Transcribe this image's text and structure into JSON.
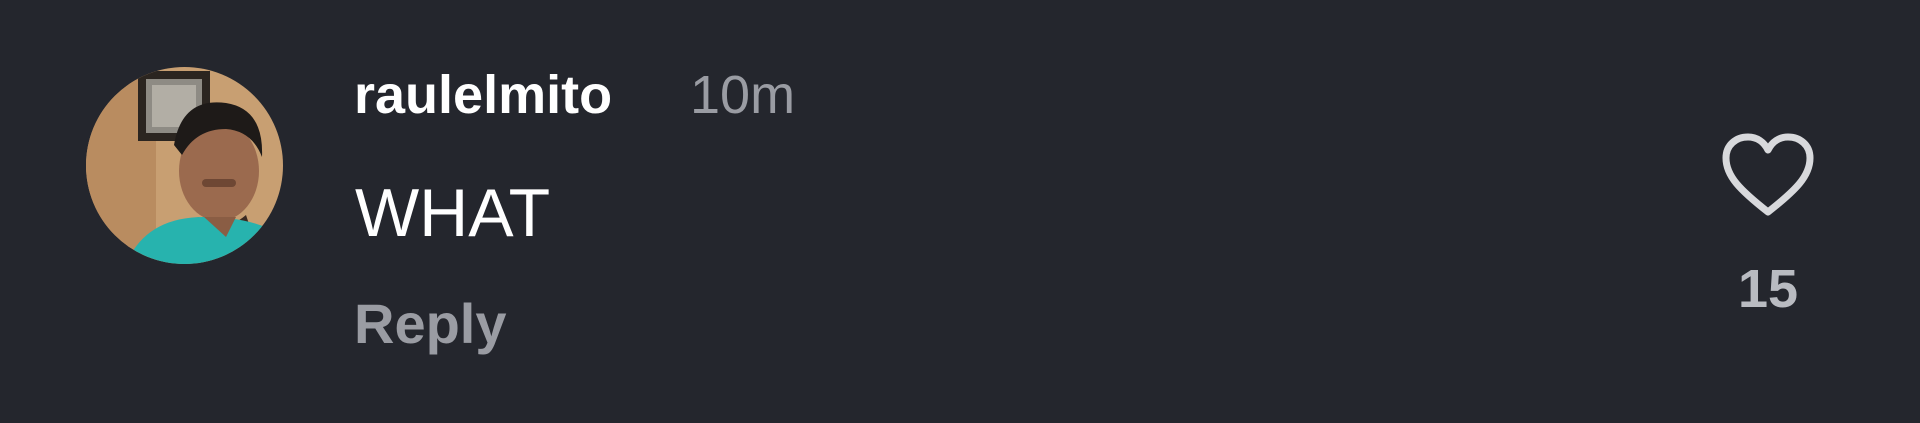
{
  "comment": {
    "username": "raulelmito",
    "timestamp": "10m",
    "text": "WHAT",
    "reply_label": "Reply",
    "like_count": "15",
    "like_icon": "heart-outline-icon"
  },
  "colors": {
    "background": "#24262d",
    "username": "#ffffff",
    "meta_text": "#9a9ca3",
    "like_count": "#b9bbc1",
    "heart_stroke": "#d8d9dc"
  }
}
